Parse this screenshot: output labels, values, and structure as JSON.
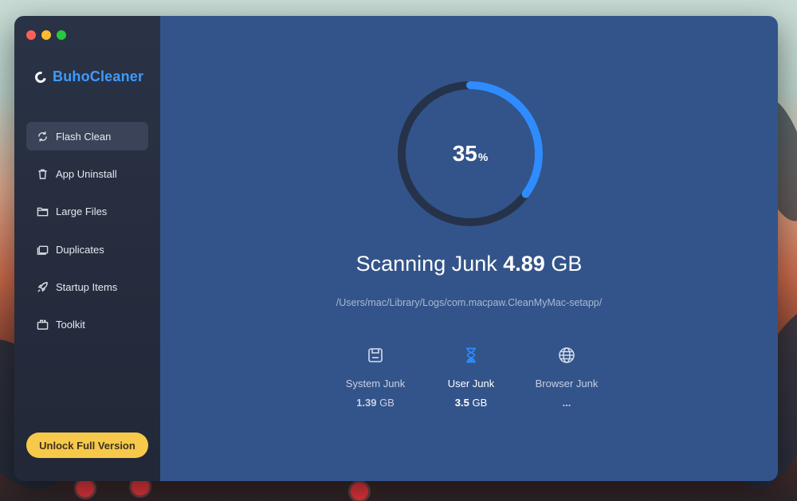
{
  "app": {
    "name": "BuhoCleaner",
    "brand_color": "#3d9bff"
  },
  "sidebar": {
    "items": [
      {
        "label": "Flash Clean",
        "icon": "refresh-icon",
        "active": true
      },
      {
        "label": "App Uninstall",
        "icon": "trash-icon",
        "active": false
      },
      {
        "label": "Large Files",
        "icon": "folder-icon",
        "active": false
      },
      {
        "label": "Duplicates",
        "icon": "duplicates-icon",
        "active": false
      },
      {
        "label": "Startup Items",
        "icon": "rocket-icon",
        "active": false
      },
      {
        "label": "Toolkit",
        "icon": "toolkit-icon",
        "active": false
      }
    ],
    "unlock_label": "Unlock Full Version"
  },
  "scan": {
    "progress_percent": 35,
    "percent_sign": "%",
    "title_prefix": "Scanning Junk",
    "size_number": "4.89",
    "size_unit": "GB",
    "current_path": "/Users/mac/Library/Logs/com.macpaw.CleanMyMac-setapp/",
    "ring_color": "#2f8cff",
    "track_color": "#26324a"
  },
  "categories": [
    {
      "label": "System Junk",
      "value_num": "1.39",
      "value_unit": "GB",
      "icon": "save-icon",
      "active": false
    },
    {
      "label": "User Junk",
      "value_num": "3.5",
      "value_unit": "GB",
      "icon": "hourglass-icon",
      "active": true
    },
    {
      "label": "Browser Junk",
      "value_num": "...",
      "value_unit": "",
      "icon": "globe-icon",
      "active": false
    }
  ]
}
